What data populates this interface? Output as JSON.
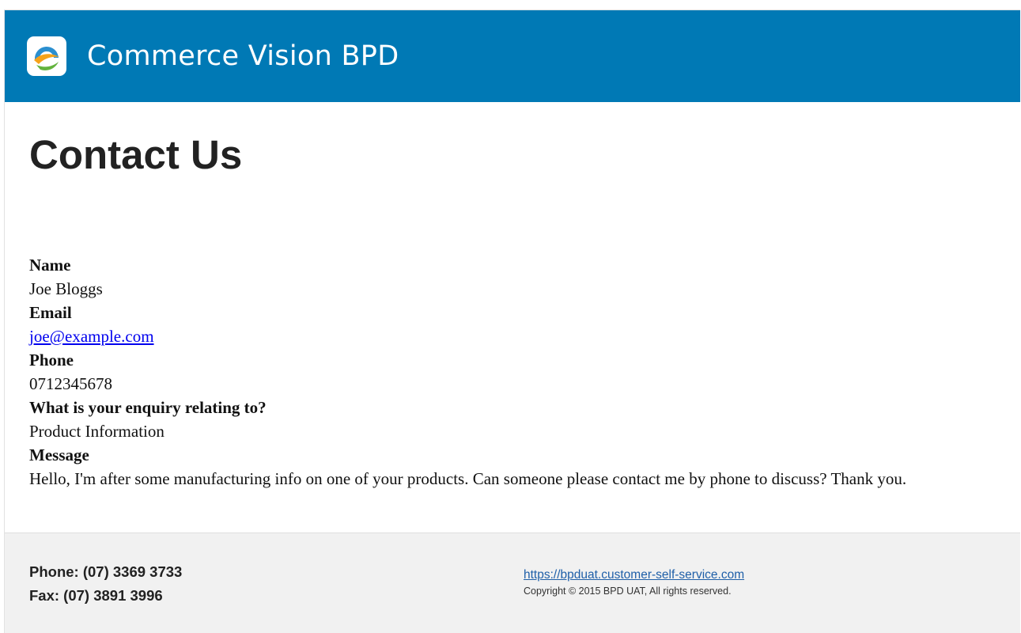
{
  "header": {
    "brand_name": "Commerce Vision BPD",
    "background_color": "#0079b5",
    "logo_icon": "commerce-vision-logo-icon"
  },
  "main": {
    "title": "Contact Us",
    "fields": {
      "name": {
        "label": "Name",
        "value": "Joe Bloggs"
      },
      "email": {
        "label": "Email",
        "value": "joe@example.com"
      },
      "phone": {
        "label": "Phone",
        "value": "0712345678"
      },
      "enquiry": {
        "label": "What is your enquiry relating to?",
        "value": "Product Information"
      },
      "message": {
        "label": "Message",
        "value": "Hello, I'm after some manufacturing info on one of your products. Can someone please contact me by phone to discuss? Thank you."
      }
    },
    "link_color": "#0000ee"
  },
  "footer": {
    "phone": "Phone: (07) 3369 3733",
    "fax": "Fax: (07) 3891 3996",
    "website": "https://bpduat.customer-self-service.com",
    "copyright": "Copyright © 2015 BPD UAT, All rights reserved.",
    "background_color": "#f1f1f1"
  }
}
